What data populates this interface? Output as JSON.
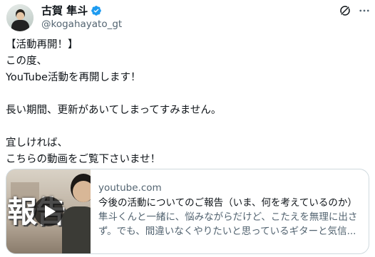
{
  "author": {
    "display_name": "古賀 隼斗",
    "handle": "@kogahayato_gt",
    "verified": true,
    "verified_color": "#1d9bf0"
  },
  "header_icons": [
    "grok-icon",
    "more-icon"
  ],
  "tweet": {
    "lines": [
      "【活動再開！】",
      "この度、",
      "YouTube活動を再開します！",
      "",
      "長い期間、更新があいてしまってすみません。",
      "",
      "宜しければ、",
      "こちらの動画をご覧下さいませ！"
    ]
  },
  "card": {
    "thumbnail_text": "報告",
    "domain": "youtube.com",
    "title": "今後の活動についてのご報告（いま、何を考えているのか）",
    "description_lines": [
      "隼斗くんと一緒に、悩みながらだけど、こたえを無理に出さ",
      "ず。でも、間違いなくやりたいと思っているギターと気信..."
    ]
  },
  "colors": {
    "text_primary": "#0f1419",
    "text_secondary": "#536471",
    "border": "#cfd9de"
  }
}
